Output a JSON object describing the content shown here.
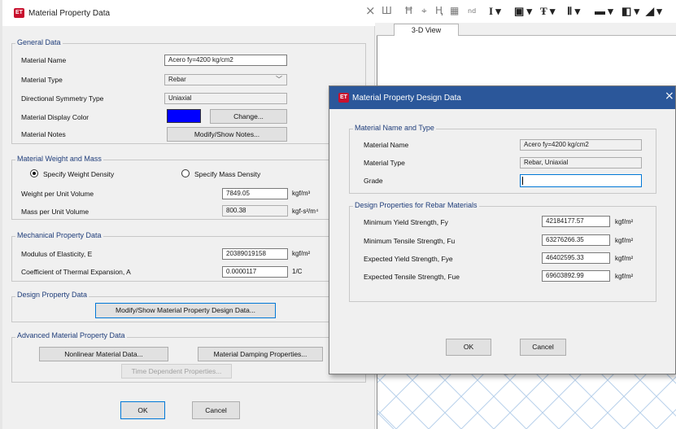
{
  "background": {
    "toolbar_glyphs": [
      "Ш",
      "Ħ",
      "⌖",
      "Ⱨ",
      "▦",
      "nd",
      "I ▾",
      "▣ ▾",
      "Ŧ ▾",
      "Ⅱ ▾",
      "▬ ▾",
      "◧ ▾",
      "◢ ▾"
    ],
    "tab_close": "×",
    "tab_label": "3-D View"
  },
  "main_dialog": {
    "title": "Material Property Data",
    "close_glyph": "×",
    "general": {
      "title": "General Data",
      "material_name_label": "Material Name",
      "material_name_value": "Acero fy=4200 kg/cm2",
      "material_type_label": "Material Type",
      "material_type_value": "Rebar",
      "symmetry_label": "Directional Symmetry Type",
      "symmetry_value": "Uniaxial",
      "display_color_label": "Material Display Color",
      "display_color": "#0000ff",
      "change_button": "Change...",
      "notes_label": "Material Notes",
      "notes_button": "Modify/Show Notes..."
    },
    "weight": {
      "title": "Material Weight and Mass",
      "radio_weight": "Specify Weight Density",
      "radio_mass": "Specify Mass Density",
      "selected": "weight",
      "weight_label": "Weight per Unit Volume",
      "weight_value": "7849.05",
      "weight_unit": "kgf/m³",
      "mass_label": "Mass per Unit Volume",
      "mass_value": "800.38",
      "mass_unit": "kgf-s²/m⁴"
    },
    "mechanical": {
      "title": "Mechanical Property Data",
      "modulus_label": "Modulus of Elasticity,  E",
      "modulus_value": "20389019158",
      "modulus_unit": "kgf/m²",
      "thermal_label": "Coefficient of Thermal Expansion,  A",
      "thermal_value": "0.0000117",
      "thermal_unit": "1/C"
    },
    "design": {
      "title": "Design Property Data",
      "button": "Modify/Show Material Property Design Data..."
    },
    "advanced": {
      "title": "Advanced Material Property Data",
      "nonlinear_button": "Nonlinear Material Data...",
      "damping_button": "Material Damping Properties...",
      "time_button": "Time Dependent Properties..."
    },
    "ok": "OK",
    "cancel": "Cancel"
  },
  "design_dialog": {
    "title": "Material Property Design Data",
    "close_glyph": "×",
    "name_type": {
      "title": "Material Name and Type",
      "name_label": "Material Name",
      "name_value": "Acero fy=4200 kg/cm2",
      "type_label": "Material Type",
      "type_value": "Rebar, Uniaxial",
      "grade_label": "Grade",
      "grade_value": ""
    },
    "rebar": {
      "title": "Design Properties for Rebar Materials",
      "rows": [
        {
          "label": "Minimum Yield Strength, Fy",
          "value": "42184177.57",
          "unit": "kgf/m²"
        },
        {
          "label": "Minimum Tensile Strength, Fu",
          "value": "63276266.35",
          "unit": "kgf/m²"
        },
        {
          "label": "Expected Yield Strength, Fye",
          "value": "46402595.33",
          "unit": "kgf/m²"
        },
        {
          "label": "Expected Tensile Strength, Fue",
          "value": "69603892.99",
          "unit": "kgf/m²"
        }
      ]
    },
    "ok": "OK",
    "cancel": "Cancel"
  },
  "colors": {
    "accent": "#0078d7",
    "design_title_bar": "#2b579a",
    "group_title": "#1f3d7a",
    "app_icon": "#c8102e"
  }
}
